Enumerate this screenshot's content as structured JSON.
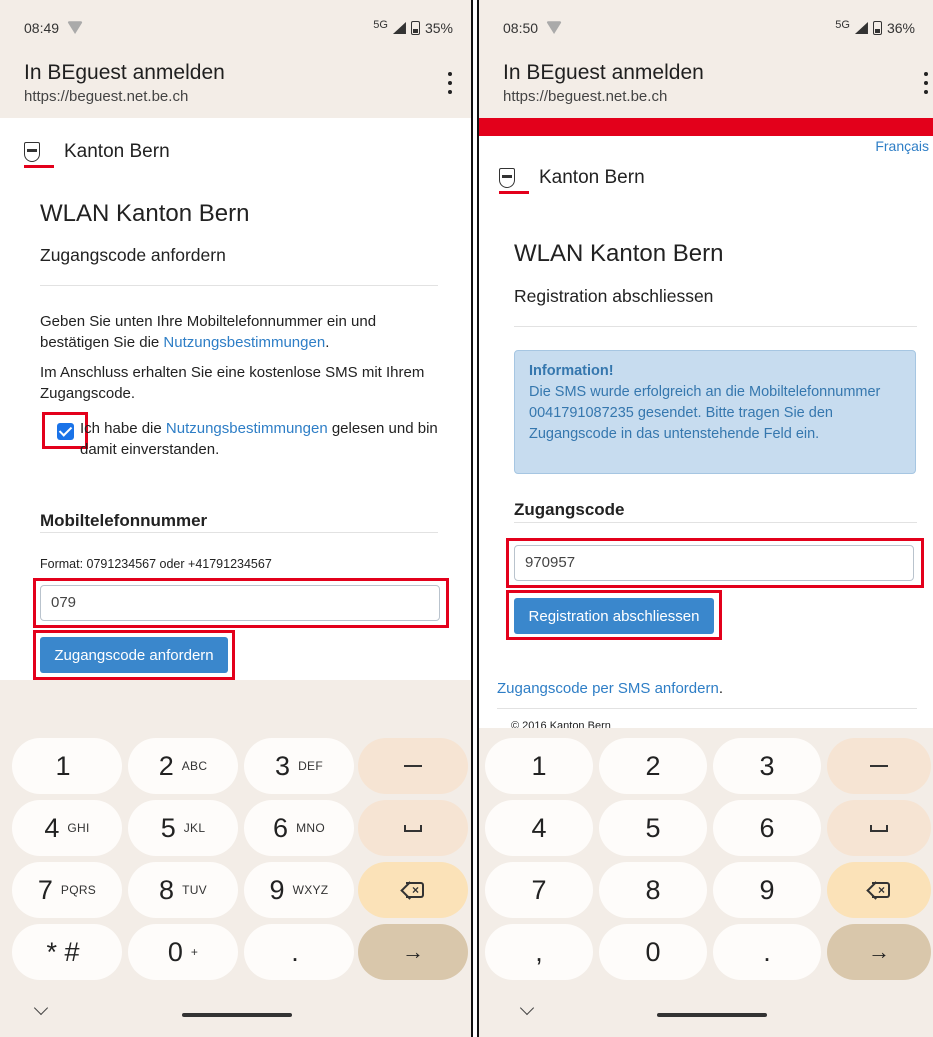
{
  "left": {
    "status": {
      "time": "08:49",
      "network": "5G",
      "battery": "35%"
    },
    "appbar": {
      "title": "In BEguest anmelden",
      "url": "https://beguest.net.be.ch"
    },
    "logo_text": "Kanton Bern",
    "heading": "WLAN Kanton Bern",
    "subheading": "Zugangscode anfordern",
    "para1_a": "Geben Sie unten Ihre Mobiltelefonnummer ein und bestätigen Sie die ",
    "para1_link": "Nutzungsbestimmungen",
    "para1_b": ".",
    "para2": "Im Anschluss erhalten Sie eine kostenlose SMS mit Ihrem Zugangscode.",
    "checkbox_a": "Ich habe die ",
    "checkbox_link": "Nutzungsbestimmungen",
    "checkbox_b": " gelesen und bin damit einverstanden.",
    "phone_label": "Mobiltelefonnummer",
    "format_hint": "Format: 0791234567 oder +41791234567",
    "phone_value": "079",
    "submit_label": "Zugangscode anfordern"
  },
  "right": {
    "status": {
      "time": "08:50",
      "network": "5G",
      "battery": "36%"
    },
    "appbar": {
      "title": "In BEguest anmelden",
      "url": "https://beguest.net.be.ch"
    },
    "lang_link": "Français",
    "logo_text": "Kanton Bern",
    "heading": "WLAN Kanton Bern",
    "subheading": "Registration abschliessen",
    "info_title": "Information!",
    "info_text": "Die SMS wurde erfolgreich an die Mobiltelefonnummer 0041791087235 gesendet. Bitte tragen Sie den Zugangscode in das untenstehende Feld ein.",
    "code_label": "Zugangscode",
    "code_value": "970957",
    "submit_label": "Registration abschliessen",
    "resend_link": "Zugangscode per SMS anfordern",
    "resend_dot": ".",
    "footer": "© 2016 Kanton Bern"
  },
  "keyboard_left": [
    {
      "digit": "1",
      "letters": ""
    },
    {
      "digit": "2",
      "letters": "ABC"
    },
    {
      "digit": "3",
      "letters": "DEF"
    },
    {
      "digit": "4",
      "letters": "GHI"
    },
    {
      "digit": "5",
      "letters": "JKL"
    },
    {
      "digit": "6",
      "letters": "MNO"
    },
    {
      "digit": "7",
      "letters": "PQRS"
    },
    {
      "digit": "8",
      "letters": "TUV"
    },
    {
      "digit": "9",
      "letters": "WXYZ"
    },
    {
      "digit": "* #",
      "letters": ""
    },
    {
      "digit": "0",
      "letters": "+"
    },
    {
      "digit": ".",
      "letters": ""
    }
  ],
  "keyboard_right": [
    {
      "digit": "1"
    },
    {
      "digit": "2"
    },
    {
      "digit": "3"
    },
    {
      "digit": "4"
    },
    {
      "digit": "5"
    },
    {
      "digit": "6"
    },
    {
      "digit": "7"
    },
    {
      "digit": "8"
    },
    {
      "digit": "9"
    },
    {
      "digit": ","
    },
    {
      "digit": "0"
    },
    {
      "digit": "."
    }
  ],
  "keyboard_fn": {
    "enter_arrow": "→"
  },
  "colors": {
    "accent_blue": "#3a87cc",
    "highlight_red": "#e3001b",
    "keyboard_bg": "#f3ede7"
  }
}
